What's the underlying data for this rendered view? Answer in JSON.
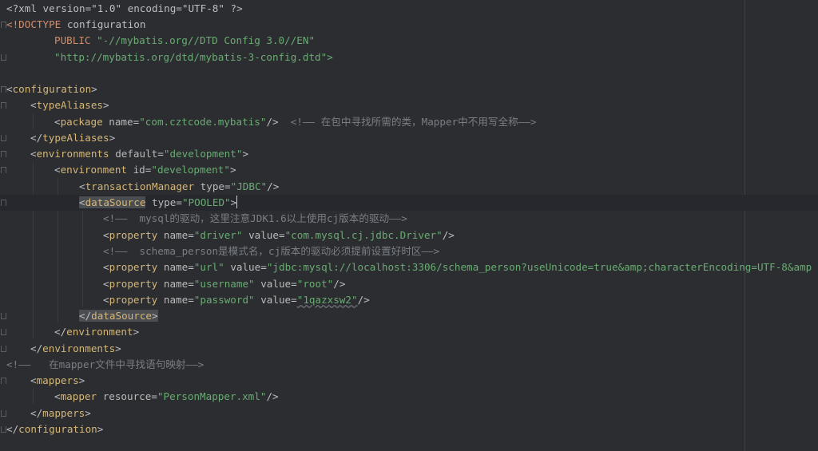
{
  "code": {
    "prolog": "<?xml version=\"1.0\" encoding=\"UTF-8\" ?>",
    "doctype": {
      "keyword": "<!DOCTYPE",
      "name": "configuration",
      "public_kw": "PUBLIC",
      "public_id": "\"-//mybatis.org//DTD Config 3.0//EN\"",
      "system_id": "\"http://mybatis.org/dtd/mybatis-3-config.dtd\">"
    },
    "configuration_tag": "configuration",
    "typeAliases_tag": "typeAliases",
    "package": {
      "tag": "package",
      "attr": "name",
      "value": "\"com.cztcode.mybatis\"",
      "comment": "<!—— 在包中寻找所需的类，Mapper中不用写全称——>"
    },
    "environments": {
      "tag": "environments",
      "attr": "default",
      "value": "\"development\""
    },
    "environment": {
      "tag": "environment",
      "attr": "id",
      "value": "\"development\""
    },
    "transactionManager": {
      "tag": "transactionManager",
      "attr": "type",
      "value": "\"JDBC\""
    },
    "dataSource": {
      "tag": "dataSource",
      "attr": "type",
      "value": "\"POOLED\""
    },
    "comment_driver": "<!——  mysql的驱动，这里注意JDK1.6以上使用cj版本的驱动——>",
    "property_tag": "property",
    "prop_driver": {
      "name_attr": "name",
      "name_value": "\"driver\"",
      "value_attr": "value",
      "value_value": "\"com.mysql.cj.jdbc.Driver\""
    },
    "comment_schema": "<!——  schema_person是模式名，cj版本的驱动必须提前设置好时区——>",
    "prop_url": {
      "name_attr": "name",
      "name_value": "\"url\"",
      "value_attr": "value",
      "value_value": "\"jdbc:mysql://localhost:3306/schema_person?useUnicode=true&amp;characterEncoding=UTF-8&amp"
    },
    "prop_username": {
      "name_attr": "name",
      "name_value": "\"username\"",
      "value_attr": "value",
      "value_value": "\"root\""
    },
    "prop_password": {
      "name_attr": "name",
      "name_value": "\"password\"",
      "value_attr": "value",
      "value_value": "\"1qazxsw2\""
    },
    "comment_mapper": "<!——   在mapper文件中寻找语句映射——>",
    "mappers_tag": "mappers",
    "mapper": {
      "tag": "mapper",
      "attr": "resource",
      "value": "\"PersonMapper.xml\""
    }
  }
}
